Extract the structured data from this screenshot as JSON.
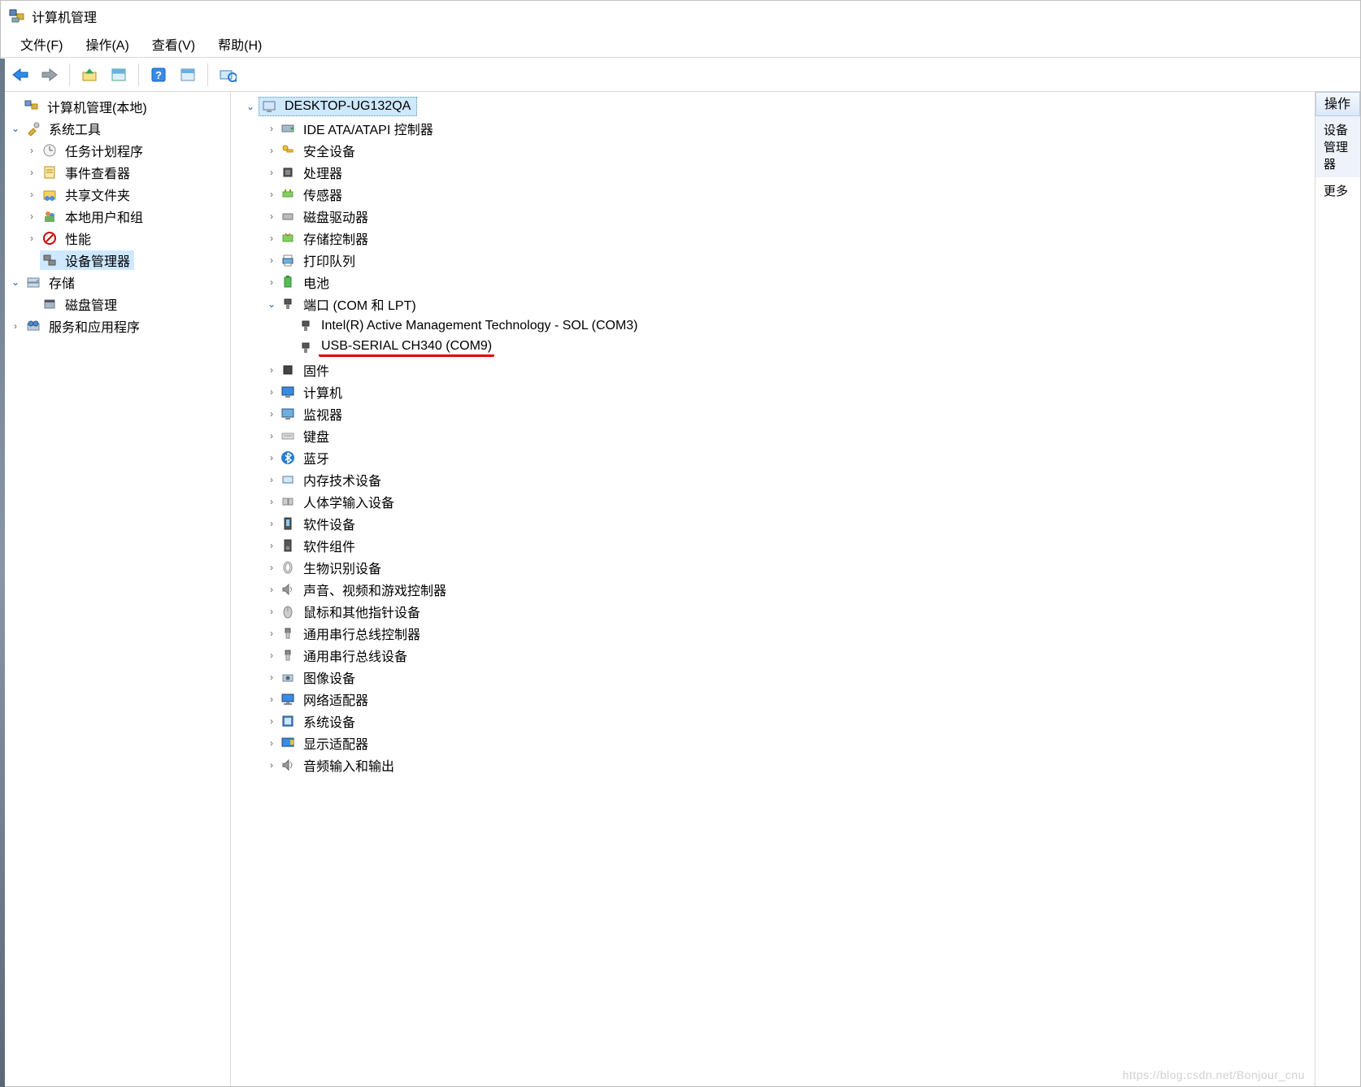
{
  "title": "计算机管理",
  "menu": {
    "file": "文件(F)",
    "action": "操作(A)",
    "view": "查看(V)",
    "help": "帮助(H)"
  },
  "left_tree": {
    "root": "计算机管理(本地)",
    "system_tools": {
      "label": "系统工具",
      "task_scheduler": "任务计划程序",
      "event_viewer": "事件查看器",
      "shared_folders": "共享文件夹",
      "local_users": "本地用户和组",
      "performance": "性能",
      "device_manager": "设备管理器"
    },
    "storage": {
      "label": "存储",
      "disk_mgmt": "磁盘管理"
    },
    "services_apps": "服务和应用程序"
  },
  "device_tree": {
    "root": "DESKTOP-UG132QA",
    "ide": "IDE ATA/ATAPI 控制器",
    "security_devices": "安全设备",
    "processors": "处理器",
    "sensors": "传感器",
    "disk_drives": "磁盘驱动器",
    "storage_controllers": "存储控制器",
    "print_queues": "打印队列",
    "batteries": "电池",
    "ports": {
      "label": "端口 (COM 和 LPT)",
      "intel_amt": "Intel(R) Active Management Technology - SOL (COM3)",
      "usb_serial": "USB-SERIAL CH340 (COM9)"
    },
    "firmware": "固件",
    "computer": "计算机",
    "monitors": "监视器",
    "keyboards": "键盘",
    "bluetooth": "蓝牙",
    "memory_tech": "内存技术设备",
    "hid": "人体学输入设备",
    "software_devices": "软件设备",
    "software_components": "软件组件",
    "biometric": "生物识别设备",
    "sound": "声音、视频和游戏控制器",
    "mice": "鼠标和其他指针设备",
    "usb_controllers": "通用串行总线控制器",
    "usb_devices": "通用串行总线设备",
    "imaging": "图像设备",
    "network": "网络适配器",
    "system_devices": "系统设备",
    "display": "显示适配器",
    "audio_io": "音频输入和输出"
  },
  "actions": {
    "header": "操作",
    "device_mgr": "设备管理器",
    "more": "更多"
  },
  "watermark": "https://blog.csdn.net/Bonjour_cnu"
}
